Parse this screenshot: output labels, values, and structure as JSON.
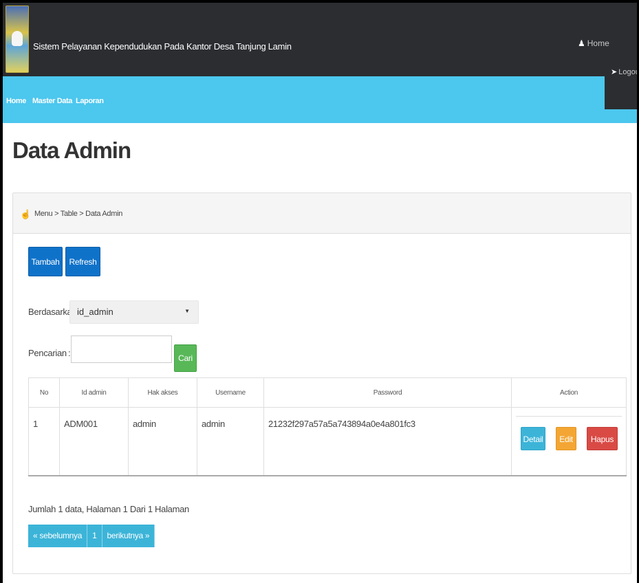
{
  "app": {
    "title": "Sistem Pelayanan Kependudukan Pada Kantor Desa Tanjung Lamin",
    "home_link": "Home",
    "logout_link": "Logout"
  },
  "nav": {
    "items": [
      {
        "label": "Home"
      },
      {
        "label": "Master Data"
      },
      {
        "label": "Laporan"
      }
    ]
  },
  "page": {
    "title": "Data Admin",
    "breadcrumb": "Menu > Table > Data Admin"
  },
  "toolbar": {
    "add_label": "Tambah",
    "refresh_label": "Refresh"
  },
  "filter": {
    "by_label": "Berdasarkan :",
    "by_selected": "id_admin",
    "search_label": "Pencarian",
    "search_colon": ":",
    "search_value": "",
    "search_button": "Cari"
  },
  "table": {
    "headers": [
      "No",
      "Id admin",
      "Hak akses",
      "Username",
      "Password",
      "Action"
    ],
    "rows": [
      {
        "no": "1",
        "id_admin": "ADM001",
        "hak_akses": "admin",
        "username": "admin",
        "password": "21232f297a57a5a743894a0e4a801fc3"
      }
    ],
    "actions": {
      "detail": "Detail",
      "edit": "Edit",
      "delete": "Hapus"
    }
  },
  "summary": "Jumlah 1 data, Halaman 1 Dari 1 Halaman",
  "pagination": {
    "prev": "« sebelumnya",
    "current": "1",
    "next": "berikutnya »"
  },
  "icons": {
    "user": "user-icon",
    "logout": "logout-icon",
    "breadcrumb": "hand-pointer-icon"
  }
}
